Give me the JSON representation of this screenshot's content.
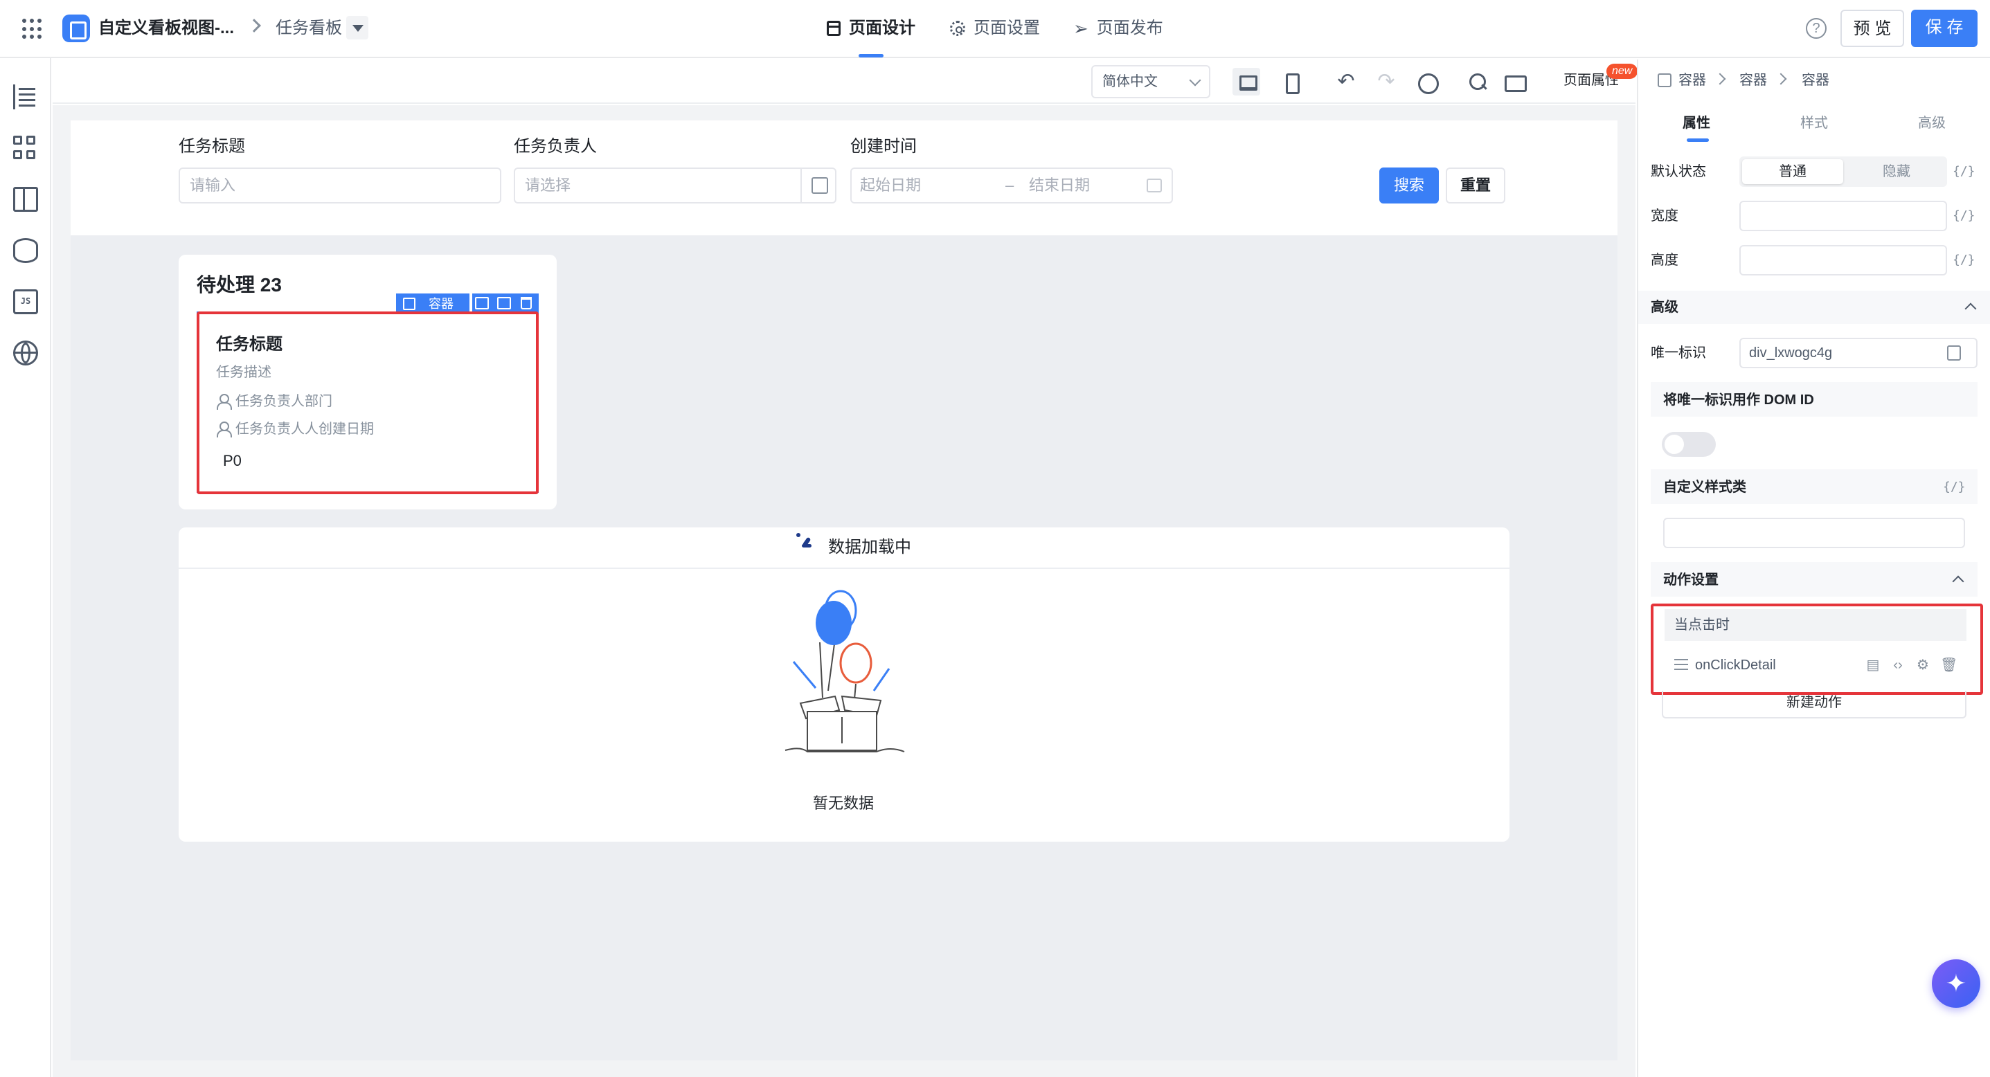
{
  "header": {
    "app_title": "自定义看板视图-...",
    "page_name": "任务看板",
    "tabs": [
      {
        "label": "页面设计",
        "active": true
      },
      {
        "label": "页面设置",
        "active": false
      },
      {
        "label": "页面发布",
        "active": false
      }
    ],
    "help_icon": "?",
    "preview_label": "预 览",
    "save_label": "保 存"
  },
  "toolbar": {
    "language": "简体中文",
    "page_props_label": "页面属性",
    "new_badge": "new",
    "undo_glyph": "↶",
    "redo_glyph": "↷"
  },
  "filter": {
    "fields": [
      {
        "label": "任务标题",
        "placeholder": "请输入"
      },
      {
        "label": "任务负责人",
        "placeholder": "请选择"
      },
      {
        "label": "创建时间",
        "start_placeholder": "起始日期",
        "range_sep": "–",
        "end_placeholder": "结束日期"
      }
    ],
    "search_label": "搜索",
    "reset_label": "重置"
  },
  "board": {
    "column_title": "待处理 23",
    "selection_toolbar_label": "容器",
    "card": {
      "title": "任务标题",
      "description": "任务描述",
      "department": "任务负责人部门",
      "creator_date": "任务负责人人创建日期",
      "priority": "P0"
    },
    "loading_text": "数据加载中",
    "empty_text": "暂无数据"
  },
  "right_panel": {
    "breadcrumb": [
      "容器",
      "容器",
      "容器"
    ],
    "tabs": [
      {
        "label": "属性",
        "active": true
      },
      {
        "label": "样式",
        "active": false
      },
      {
        "label": "高级",
        "active": false
      }
    ],
    "default_state_label": "默认状态",
    "state_options": [
      {
        "label": "普通",
        "selected": true
      },
      {
        "label": "隐藏",
        "selected": false
      }
    ],
    "width_label": "宽度",
    "height_label": "高度",
    "fx_glyph": "{/}",
    "advanced_section": "高级",
    "unique_id_label": "唯一标识",
    "unique_id_value": "div_lxwogc4g",
    "dom_id_label": "将唯一标识用作 DOM ID",
    "dom_id_enabled": false,
    "custom_class_label": "自定义样式类",
    "action_section": "动作设置",
    "action_event": "当点击时",
    "action_handler": "onClickDetail",
    "new_action_label": "新建动作"
  },
  "fab": {
    "glyph": "✦",
    "icon": "ai-assistant-icon"
  },
  "colors": {
    "primary": "#3a7ff6",
    "highlight": "#e5343a",
    "badge": "#f5522d"
  }
}
